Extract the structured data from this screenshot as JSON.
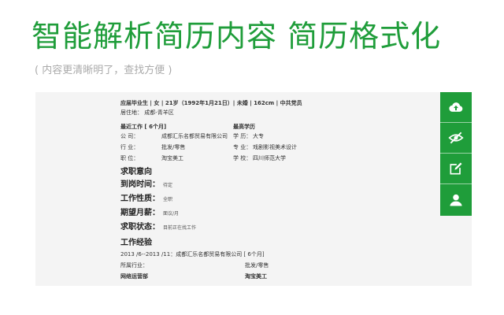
{
  "headline": "智能解析简历内容 简历格式化",
  "subtitle": "( 内容更清晰明了，查找方便 )",
  "colors": {
    "accent": "#1f9d3a",
    "panel_bg": "#f4f4f4",
    "subtitle": "#aaaaaa"
  },
  "resume": {
    "summary": "应届毕业生 | 女 | 21岁（1992年1月21日）| 未婚 | 162cm | 中共党员",
    "residence": "居住地： 成都-青羊区",
    "recent_job": {
      "heading": "最近工作 [ 6个月]",
      "items": [
        {
          "label": "公    司：",
          "value": "成都汇乐名都贸易有限公司"
        },
        {
          "label": "行    业：",
          "value": "批发/零售"
        },
        {
          "label": "职    位：",
          "value": "淘宝美工"
        }
      ]
    },
    "education": {
      "heading": "最高学历",
      "items": [
        {
          "label": "学    历：",
          "value": "大专"
        },
        {
          "label": "专    业：",
          "value": "戏剧影视美术设计"
        },
        {
          "label": "学    校：",
          "value": "四川师范大学"
        }
      ]
    },
    "intention": {
      "heading": "求职意向",
      "items": [
        {
          "label": "到岗时间：",
          "value": "待定"
        },
        {
          "label": "工作性质：",
          "value": "全职"
        },
        {
          "label": "期望月薪：",
          "value": "面议/月"
        },
        {
          "label": "求职状态：",
          "value": "目前正在找工作"
        }
      ]
    },
    "experience": {
      "heading": "工作经验",
      "period": "2013 /6--2013 /11：成都汇乐名都贸易有限公司 [ 6个月]",
      "industry_label": "所属行业：",
      "industry_value": "批发/零售",
      "department": "网络运营部",
      "position": "淘宝美工"
    }
  },
  "sidebar": {
    "icons": [
      "cloud-upload-icon",
      "eye-off-icon",
      "edit-icon",
      "user-icon"
    ]
  }
}
